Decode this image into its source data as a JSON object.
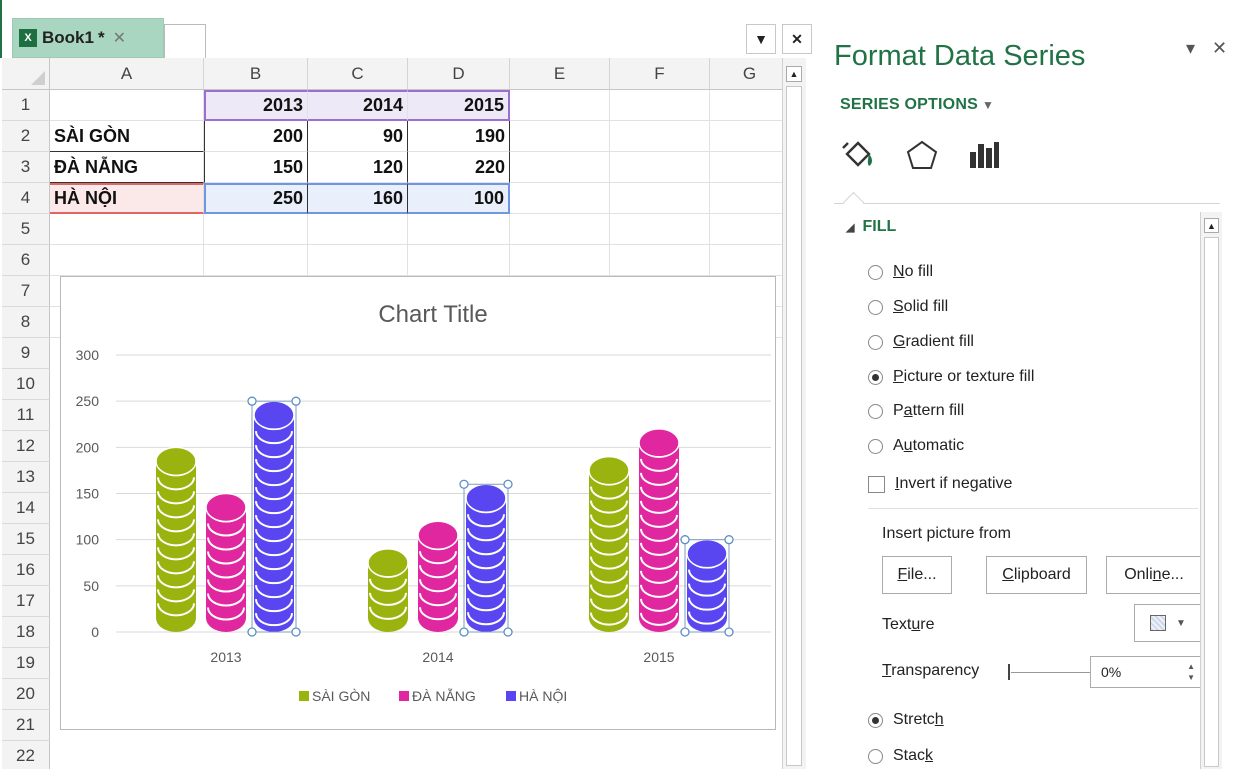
{
  "workbook": {
    "tab_name": "Book1",
    "tab_modified": "*",
    "columns": [
      "A",
      "B",
      "C",
      "D",
      "E",
      "F",
      "G"
    ],
    "rows": [
      "1",
      "2",
      "3",
      "4",
      "5",
      "6",
      "7",
      "8",
      "9",
      "10",
      "11",
      "12",
      "13",
      "14",
      "15",
      "16",
      "17",
      "18",
      "19",
      "20",
      "21",
      "22"
    ],
    "cells": {
      "header": [
        "",
        "2013",
        "2014",
        "2015"
      ],
      "r2": [
        "SÀI GÒN",
        "200",
        "90",
        "190"
      ],
      "r3": [
        "ĐÀ NẴNG",
        "150",
        "120",
        "220"
      ],
      "r4": [
        "HÀ NỘI",
        "250",
        "160",
        "100"
      ]
    }
  },
  "chart_data": {
    "type": "bar",
    "title": "Chart Title",
    "categories": [
      "2013",
      "2014",
      "2015"
    ],
    "series": [
      {
        "name": "SÀI GÒN",
        "values": [
          200,
          90,
          190
        ],
        "color": "#9bb30e"
      },
      {
        "name": "ĐÀ NẴNG",
        "values": [
          150,
          120,
          220
        ],
        "color": "#e0279f"
      },
      {
        "name": "HÀ NỘI",
        "values": [
          250,
          160,
          100
        ],
        "color": "#5a46f0"
      }
    ],
    "yticks": [
      0,
      50,
      100,
      150,
      200,
      250,
      300
    ],
    "ylim": [
      0,
      300
    ],
    "grid": true,
    "legend": "bottom",
    "selected_series": "HÀ NỘI",
    "fill_style": "stacked-coins"
  },
  "pane": {
    "title": "Format Data Series",
    "section": "SERIES OPTIONS",
    "fill_header": "FILL",
    "fill_options": [
      {
        "pre": "",
        "key": "N",
        "post": "o fill",
        "selected": false
      },
      {
        "pre": "",
        "key": "S",
        "post": "olid fill",
        "selected": false
      },
      {
        "pre": "",
        "key": "G",
        "post": "radient fill",
        "selected": false
      },
      {
        "pre": "",
        "key": "P",
        "post": "icture or texture fill",
        "selected": true
      },
      {
        "pre": "P",
        "key": "a",
        "post": "ttern fill",
        "selected": false
      },
      {
        "pre": "A",
        "key": "u",
        "post": "tomatic",
        "selected": false
      }
    ],
    "invert": {
      "pre": "",
      "key": "I",
      "post": "nvert if negative"
    },
    "insert_from_label": "Insert picture from",
    "buttons": {
      "file": {
        "pre": "",
        "key": "F",
        "post": "ile..."
      },
      "clipboard": {
        "pre": "",
        "key": "C",
        "post": "lipboard"
      },
      "online": {
        "pre": "Onli",
        "key": "n",
        "post": "e..."
      }
    },
    "texture_label": {
      "pre": "Text",
      "key": "u",
      "post": "re"
    },
    "transparency_label": {
      "pre": "",
      "key": "T",
      "post": "ransparency"
    },
    "transparency_value": "0%",
    "stretch": {
      "pre": "Stretc",
      "key": "h",
      "post": ""
    },
    "stack": {
      "pre": "Stac",
      "key": "k",
      "post": ""
    },
    "icons": [
      "paint-bucket-icon",
      "pentagon-icon",
      "bar-chart-icon"
    ]
  }
}
